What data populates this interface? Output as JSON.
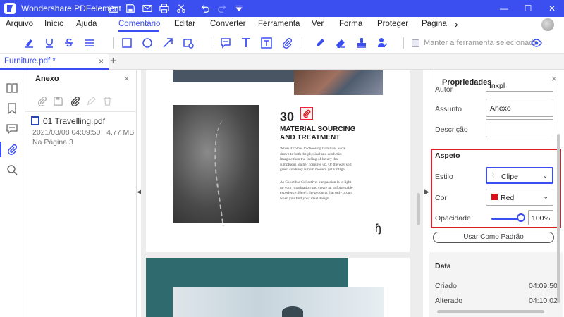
{
  "window": {
    "title": "Wondershare PDFelement"
  },
  "menu": {
    "items": [
      "Arquivo",
      "Início",
      "Ajuda",
      "Comentário",
      "Editar",
      "Converter",
      "Ferramenta",
      "Ver",
      "Forma",
      "Proteger",
      "Página"
    ],
    "active": "Comentário",
    "more_glyph": "›"
  },
  "toolbar": {
    "tools": [
      "highlight-icon",
      "underline-icon",
      "strikethrough-icon",
      "lines-menu-icon",
      "rectangle-icon",
      "circle-icon",
      "arrow-icon",
      "shape-menu-icon",
      "note-icon",
      "text-icon",
      "textbox-icon",
      "attach-icon",
      "pencil-icon",
      "eraser-icon",
      "stamp-icon",
      "signature-menu-icon",
      "eye-icon"
    ],
    "keep_tool_label": "Manter a ferramenta selecionada",
    "keep_tool_checked": true
  },
  "tabs": {
    "doc_label": "Furniture.pdf *",
    "close_glyph": "×",
    "add_glyph": "+"
  },
  "attachments": {
    "title": "Anexo",
    "close_glyph": "×",
    "file": {
      "name": "01 Travelling.pdf",
      "date": "2021/03/08 04:09:50",
      "size": "4,77 MB",
      "page": "Na Página 3"
    }
  },
  "document": {
    "page_number": "30",
    "heading": "MATERIAL SOURCING AND TREATMENT",
    "paragraph1": "When it comes to choosing furniture, we're drawn to both the physical and aesthetic. Imagine then the feeling of luxury that sumptuous leather conjures up. Or the way soft green corduroy is both modern yet vintage.",
    "paragraph2": "As Columbia Collective, our passion is to light up your imagination and create an unforgettable experience. Here's the products that only occurs when you find your ideal design.",
    "cursor_glyph": "ɧ"
  },
  "properties": {
    "title": "Propriedades",
    "close_glyph": "×",
    "autor_label": "Autor",
    "autor_value": "Inxpl",
    "assunto_label": "Assunto",
    "assunto_value": "Anexo",
    "descricao_label": "Descrição",
    "descricao_value": "",
    "aspeto_title": "Aspeto",
    "estilo_label": "Estilo",
    "estilo_value": "Clipe",
    "cor_label": "Cor",
    "cor_value": "Red",
    "cor_hex": "#d8111b",
    "opacidade_label": "Opacidade",
    "opacidade_value": "100",
    "opacidade_unit": "%",
    "opacidade_fraction": 1.0,
    "default_button": "Usar Como Padrão",
    "data_title": "Data",
    "criado_label": "Criado",
    "criado_value": "04:09:50",
    "alterado_label": "Alterado",
    "alterado_value": "04:10:02",
    "highlight_color": "#e01c24"
  },
  "colors": {
    "accent": "#3b4ef0",
    "teal": "#2f6b6e"
  }
}
